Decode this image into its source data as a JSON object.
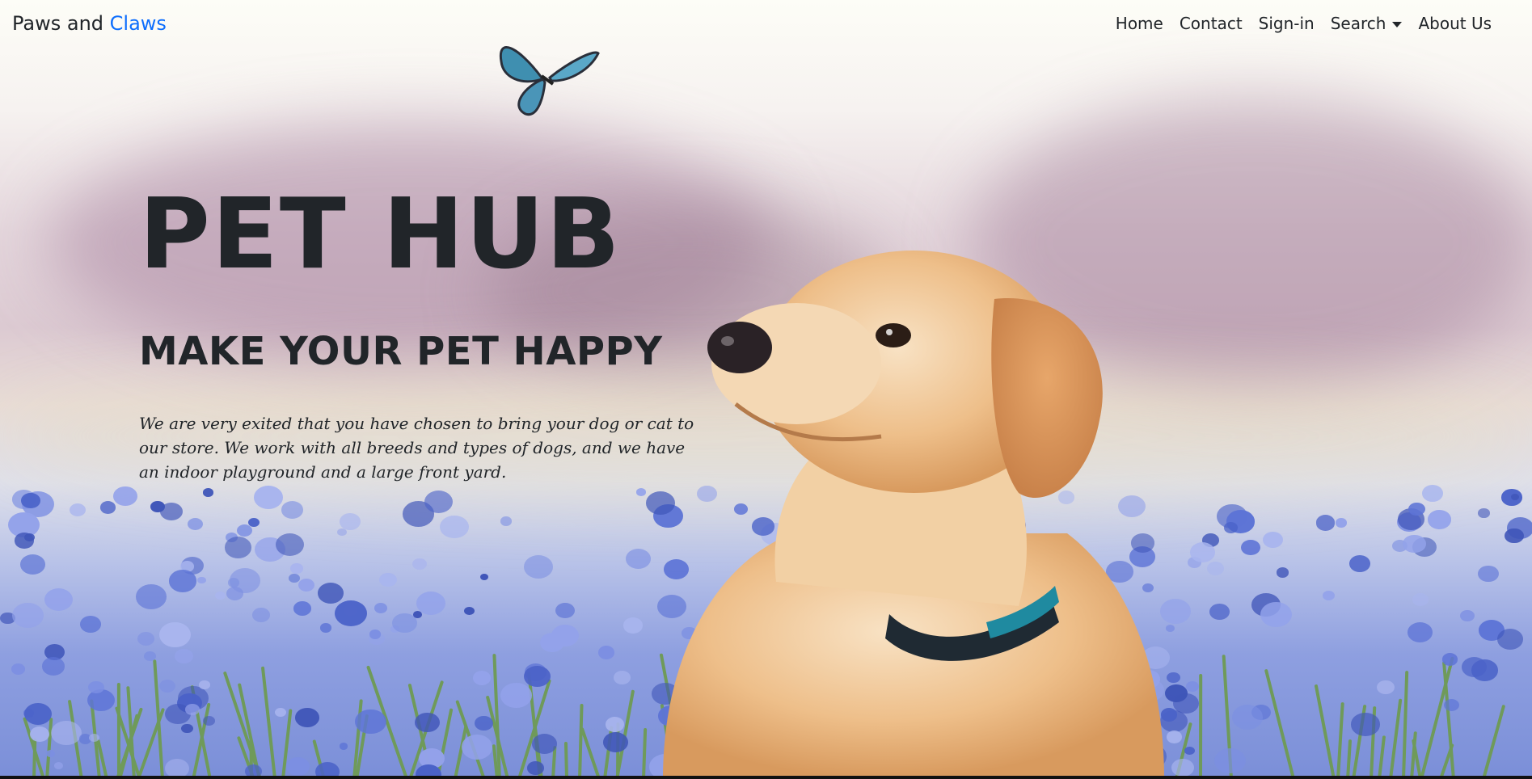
{
  "navbar": {
    "brand_part1": "Paws and",
    "brand_part2": "Claws",
    "items": [
      {
        "label": "Home"
      },
      {
        "label": "Contact"
      },
      {
        "label": "Sign-in"
      },
      {
        "label": "Search"
      },
      {
        "label": "About Us"
      }
    ]
  },
  "hero": {
    "title": "PET HUB",
    "subtitle": "MAKE YOUR PET HAPPY",
    "description": "We are very exited that you have chosen to bring your dog or cat to our store. We work with all breeds and types of dogs, and we have an indoor playground and a large front yard."
  },
  "colors": {
    "brand_accent": "#0d6efd",
    "text": "#212529"
  },
  "icons": {
    "search_dropdown": "chevron-down-icon"
  }
}
